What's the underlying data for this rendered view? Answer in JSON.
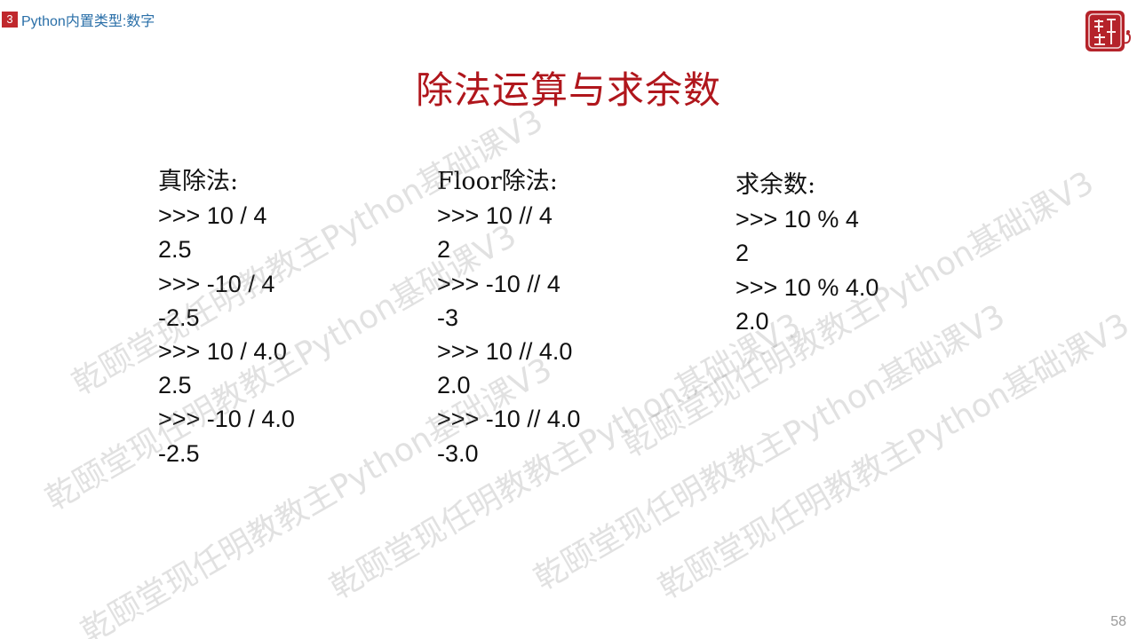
{
  "header": {
    "section_number": "3",
    "section_title": "Python内置类型:数字"
  },
  "logo": {
    "alt": "乾颐堂"
  },
  "title": "除法运算与求余数",
  "columns": [
    {
      "heading": "真除法:",
      "lines": [
        ">>> 10 / 4",
        "2.5",
        ">>> -10 / 4",
        "-2.5",
        ">>> 10 / 4.0",
        "2.5",
        ">>> -10 / 4.0",
        "-2.5"
      ]
    },
    {
      "heading": "Floor除法:",
      "lines": [
        ">>> 10 // 4",
        "2",
        ">>> -10 // 4",
        "-3",
        ">>> 10 // 4.0",
        "2.0",
        ">>> -10 // 4.0",
        "-3.0"
      ]
    },
    {
      "heading": "求余数:",
      "lines": [
        ">>> 10 % 4",
        "2",
        ">>> 10 % 4.0",
        "2.0"
      ]
    }
  ],
  "watermark_text": "乾颐堂现任明教教主Python基础课V3",
  "page_number": "58",
  "colors": {
    "title": "#b0161c",
    "section_badge": "#c0282d",
    "section_title": "#2a6fa8",
    "watermark": "#787878"
  }
}
